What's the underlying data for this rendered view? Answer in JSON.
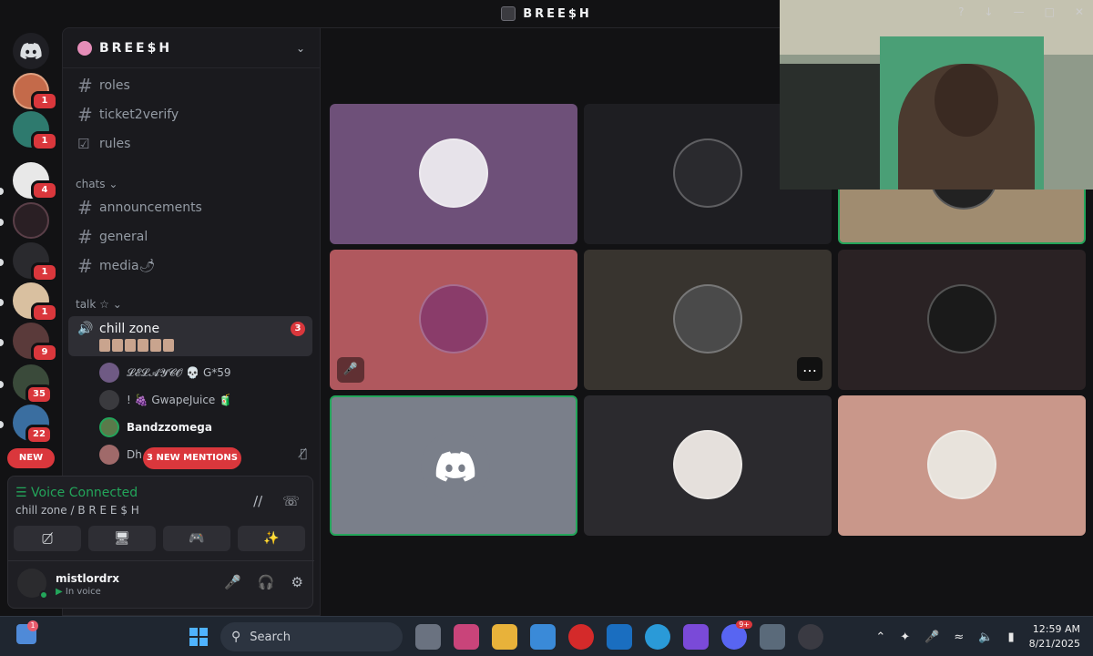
{
  "window": {
    "title": "BREE$H"
  },
  "rail": {
    "badges": [
      "1",
      "1",
      "4",
      "1",
      "1",
      "9",
      "35",
      "22"
    ],
    "new_label": "NEW"
  },
  "server": {
    "name": "BREE$H"
  },
  "channels_top": [
    {
      "name": "roles"
    },
    {
      "name": "ticket2verify"
    },
    {
      "name": "rules"
    }
  ],
  "categories": {
    "chats": "chats",
    "talk": "talk ☆"
  },
  "channels_chat": [
    {
      "name": "announcements"
    },
    {
      "name": "general"
    },
    {
      "name": "media🌶"
    }
  ],
  "voice_channel": {
    "name": "chill zone",
    "count": "3"
  },
  "voice_users": [
    {
      "name": "𝓛𝓔𝓛𝓐𝓨𝓒𝓞 💀 G*59"
    },
    {
      "name": "! 🍇 GwapeJuice 🧃"
    },
    {
      "name": "Bandzzomega"
    },
    {
      "name": "Dh"
    }
  ],
  "mentions_pill": "3 NEW MENTIONS",
  "voice_panel": {
    "status": "Voice Connected",
    "location": "chill zone / B R E E $ H"
  },
  "user": {
    "name": "mistlordrx",
    "status": "In voice"
  },
  "tiles": [
    {
      "bg": "#6e5079",
      "avbg": "#e7e3ea",
      "speaking": false,
      "muted": false
    },
    {
      "bg": "#1e1e22",
      "avbg": "#2a2a2e",
      "speaking": false,
      "muted": false
    },
    {
      "bg": "#a08c70",
      "avbg": "#222",
      "speaking": true,
      "muted": false
    },
    {
      "bg": "#b0585e",
      "avbg": "#8a3c6a",
      "speaking": false,
      "muted": true
    },
    {
      "bg": "#38342f",
      "avbg": "#4a4a4a",
      "speaking": false,
      "muted": false,
      "more": true
    },
    {
      "bg": "#2a2224",
      "avbg": "#1a1a1a",
      "speaking": false,
      "muted": false
    },
    {
      "bg": "#7a7f8a",
      "avbg": "#7a7f8a",
      "speaking": true,
      "muted": false,
      "discord": true
    },
    {
      "bg": "#2b2a2e",
      "avbg": "#e5e0dc",
      "speaking": false,
      "muted": false
    },
    {
      "bg": "#c9978a",
      "avbg": "#e8e3dc",
      "speaking": false,
      "muted": false
    }
  ],
  "taskbar": {
    "search_placeholder": "Search",
    "time": "12:59 AM",
    "date": "8/21/2025",
    "widget_badge": "1",
    "discord_badge": "9+"
  },
  "colors": {
    "accent_green": "#23a55a",
    "badge_red": "#da373c",
    "bg": "#121214"
  }
}
